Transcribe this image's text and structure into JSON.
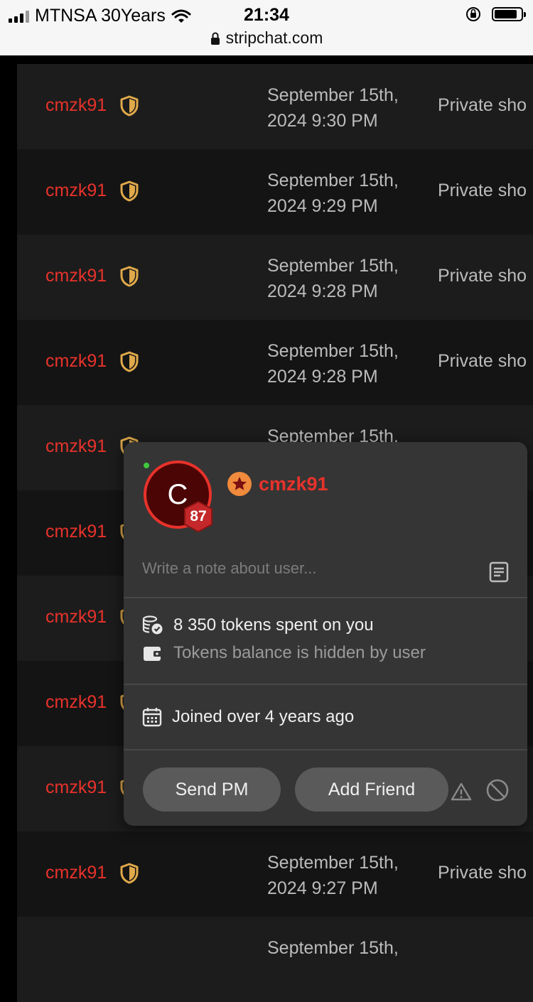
{
  "status_bar": {
    "carrier": "MTNSA 30Years",
    "time": "21:34",
    "url": "stripchat.com"
  },
  "list": {
    "rows": [
      {
        "user": "cmzk91",
        "date": "September 15th, 2024 9:30 PM",
        "type": "Private sho"
      },
      {
        "user": "cmzk91",
        "date": "September 15th, 2024 9:29 PM",
        "type": "Private sho"
      },
      {
        "user": "cmzk91",
        "date": "September 15th, 2024 9:28 PM",
        "type": "Private sho"
      },
      {
        "user": "cmzk91",
        "date": "September 15th, 2024 9:28 PM",
        "type": "Private sho"
      },
      {
        "user": "cmzk91",
        "date": "September 15th,",
        "type": ""
      },
      {
        "user": "cmzk91",
        "date": "",
        "type": ""
      },
      {
        "user": "cmzk91",
        "date": "",
        "type": ""
      },
      {
        "user": "cmzk91",
        "date": "",
        "type": ""
      },
      {
        "user": "cmzk91",
        "date": "",
        "type": ""
      },
      {
        "user": "cmzk91",
        "date": "September 15th, 2024 9:27 PM",
        "type": "Private sho"
      },
      {
        "user": "",
        "date": "September 15th,",
        "type": ""
      }
    ]
  },
  "popup": {
    "avatar_letter": "C",
    "level": "87",
    "username": "cmzk91",
    "note_placeholder": "Write a note about user...",
    "tokens_spent": "8 350 tokens spent on you",
    "tokens_balance": "Tokens balance is hidden by user",
    "joined": "Joined over 4 years ago",
    "send_pm": "Send PM",
    "add_friend": "Add Friend"
  },
  "colors": {
    "accent_red": "#e8322b",
    "shield_gold": "#e0a94a",
    "star_orange": "#f08a3c"
  }
}
